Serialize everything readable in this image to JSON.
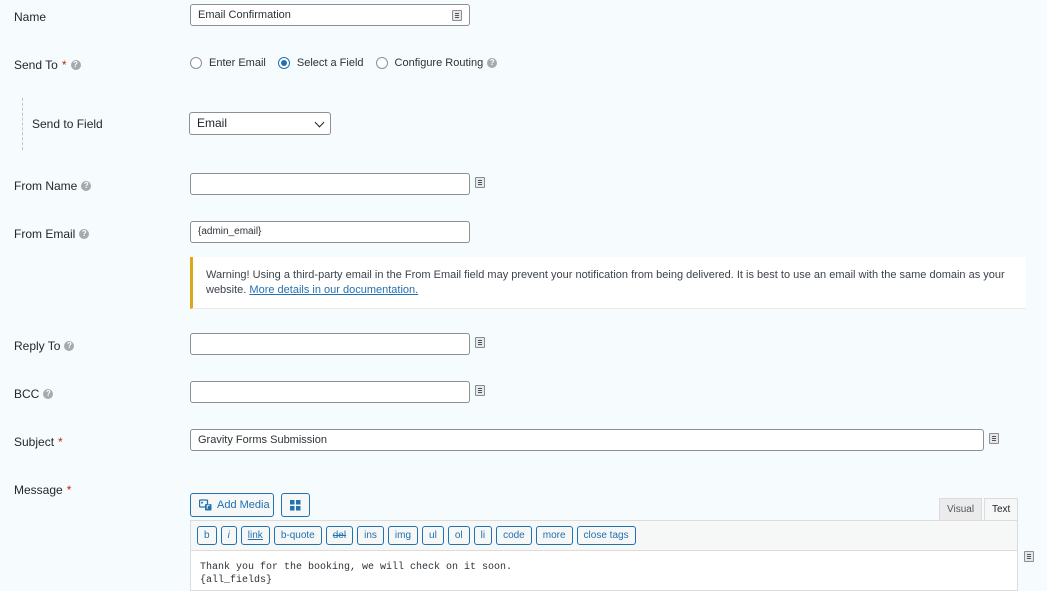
{
  "fields": {
    "name": {
      "label": "Name",
      "value": "Email Confirmation"
    },
    "send_to": {
      "label": "Send To",
      "required_mark": "*",
      "options": [
        {
          "label": "Enter Email",
          "selected": false
        },
        {
          "label": "Select a Field",
          "selected": true
        },
        {
          "label": "Configure Routing",
          "selected": false
        }
      ]
    },
    "send_to_field": {
      "label": "Send to Field",
      "value": "Email"
    },
    "from_name": {
      "label": "From Name",
      "value": ""
    },
    "from_email": {
      "label": "From Email",
      "value": "{admin_email}"
    },
    "warning": {
      "text": "Warning! Using a third-party email in the From Email field may prevent your notification from being delivered. It is best to use an email with the same domain as your website.",
      "link_text": "More details in our documentation."
    },
    "reply_to": {
      "label": "Reply To",
      "value": ""
    },
    "bcc": {
      "label": "BCC",
      "value": ""
    },
    "subject": {
      "label": "Subject",
      "required_mark": "*",
      "value": "Gravity Forms Submission"
    },
    "message": {
      "label": "Message",
      "required_mark": "*",
      "add_media_label": "Add Media",
      "tabs": {
        "visual": "Visual",
        "text": "Text",
        "active": "Text"
      },
      "quicktags": [
        "b",
        "i",
        "link",
        "b-quote",
        "del",
        "ins",
        "img",
        "ul",
        "ol",
        "li",
        "code",
        "more",
        "close tags"
      ],
      "content_line1": "Thank you for the booking, we will check on it soon.",
      "content_line2": "{all_fields}"
    }
  },
  "help_icon_glyph": "?",
  "colors": {
    "accent": "#2271b1",
    "required": "#c02b0a",
    "warning_border": "#dba617",
    "background": "#f6fbfe"
  }
}
